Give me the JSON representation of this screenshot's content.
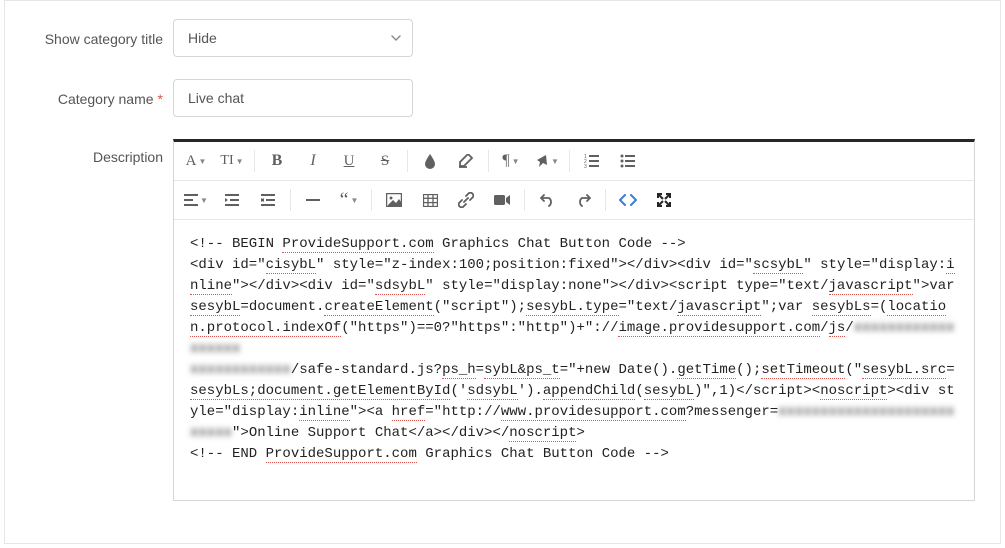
{
  "labels": {
    "show_category_title": "Show category title",
    "category_name": "Category name",
    "description": "Description"
  },
  "fields": {
    "show_category_title_value": "Hide",
    "category_name_value": "Live chat"
  },
  "toolbar": {
    "row1": {
      "font_family": "A",
      "font_size": "TI",
      "bold": "B",
      "italic": "I",
      "underline": "U",
      "strike": "S"
    }
  },
  "redacted": {
    "r1": "xxxxxxxxxxxxxxxxxx",
    "r2": "xxxxxxxxxxxx",
    "r3": "xxxxxxxxxxxxxxxxxxxxxxxxxx"
  },
  "description_code": {
    "l1a": "<!-- BEGIN ",
    "l1b": "ProvideSupport.com",
    "l1c": " Graphics Chat Button Code -->",
    "l2a": "<div id=\"",
    "l2b": "cisybL",
    "l2c": "\" style=\"z-index:100;position:fixed\"></div><div id=\"",
    "l2d": "scsybL",
    "l2e": "\" style=\"display:",
    "l2f": "inline",
    "l2g": "\"></div><div id=\"",
    "l2h": "sdsybL",
    "l2i": "\" style=\"display:none\"></div><script type=\"text/",
    "l2j": "javascript",
    "l2k": "\">var ",
    "l2l": "sesybL",
    "l2m": "=document.",
    "l2n": "createElement",
    "l2o": "(\"script\");",
    "l2p": "sesybL.type",
    "l2q": "=\"text/",
    "l2r": "javascript",
    "l2s": "\";var ",
    "l2t": "sesybLs",
    "l2u": "=(",
    "l2v": "location.protocol.indexOf",
    "l2w": "(\"https\")==0?\"https\":\"http\")+\"://",
    "l2x": "image.providesupport.com",
    "l2y": "/",
    "l2z": "js",
    "l3a": "/",
    "l3c": "/safe-standard.js?",
    "l3d": "ps_h",
    "l3e": "=",
    "l3f": "sybL&ps_t",
    "l3g": "=\"+new Date().",
    "l3h": "getTime",
    "l3i": "();",
    "l3j": "setTimeout",
    "l3k": "(\"",
    "l3l": "sesybL.src",
    "l3m": "=",
    "l3n": "sesybLs;document.getElementById",
    "l3o": "('",
    "l3p": "sdsybL",
    "l3q": "').",
    "l3r": "appendChild",
    "l3s": "(",
    "l3t": "sesybL",
    "l3u": ")\",1)</script><",
    "l3v": "noscript",
    "l3w": "><div style=\"display:",
    "l3x": "inline",
    "l3y": "\"><a ",
    "l3z": "href",
    "l4a": "=\"http://",
    "l4b": "www.providesupport.com",
    "l4c": "?messenger=",
    "l4e": "\">Online Support Chat</a></div></",
    "l4f": "noscript",
    "l4g": ">",
    "l5a": "<!-- END ",
    "l5b": "ProvideSupport.com",
    "l5c": " Graphics Chat Button Code -->"
  }
}
